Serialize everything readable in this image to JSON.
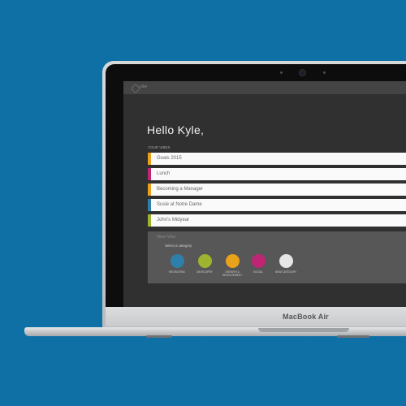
{
  "device": {
    "brand": "MacBook Air"
  },
  "app": {
    "logo_text": "vibe",
    "greeting": "Hello Kyle,",
    "section_label": "YOUR VIBES",
    "vibes": [
      {
        "label": "Goals 2015",
        "color": "#e8a21b"
      },
      {
        "label": "Lunch",
        "color": "#c02575"
      },
      {
        "label": "Becoming a Manager",
        "color": "#e8a21b"
      },
      {
        "label": "Susie at Notre Dame",
        "color": "#2f7fab"
      },
      {
        "label": "John's Midyear",
        "color": "#9fb42e"
      }
    ],
    "new_vibe": {
      "title": "New Vibe",
      "select_label": "Select a category",
      "categories": [
        {
          "label": "RECRUITING",
          "color": "#2f7fab"
        },
        {
          "label": "DEVELOPER",
          "color": "#9fb42e"
        },
        {
          "label": "GROWTH & DEVELOPMENT",
          "color": "#e8a21b"
        },
        {
          "label": "SOCIAL",
          "color": "#c02575"
        },
        {
          "label": "NEW CATEGORY",
          "color": "#e6e6e6"
        }
      ]
    }
  }
}
